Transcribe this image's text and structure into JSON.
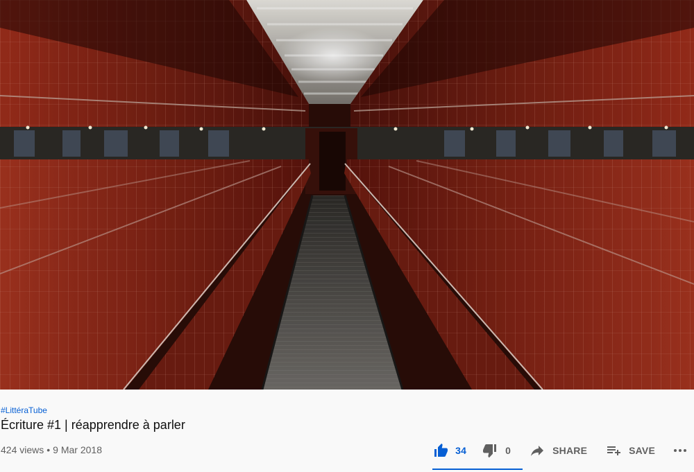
{
  "video": {
    "hashtag": "#LittéraTube",
    "title": "Écriture #1 | réapprendre à parler",
    "views": "424 views",
    "date": "9 Mar 2018"
  },
  "actions": {
    "like_count": "34",
    "dislike_count": "0",
    "share_label": "SHARE",
    "save_label": "SAVE"
  },
  "sentiment": {
    "like_fraction": 1.0
  },
  "colors": {
    "accent": "#065fd4",
    "tile_red": "#8a2418",
    "background": "#f9f9f9"
  },
  "icons": [
    "thumb-up-icon",
    "thumb-down-icon",
    "share-icon",
    "playlist-add-icon",
    "more-icon"
  ]
}
